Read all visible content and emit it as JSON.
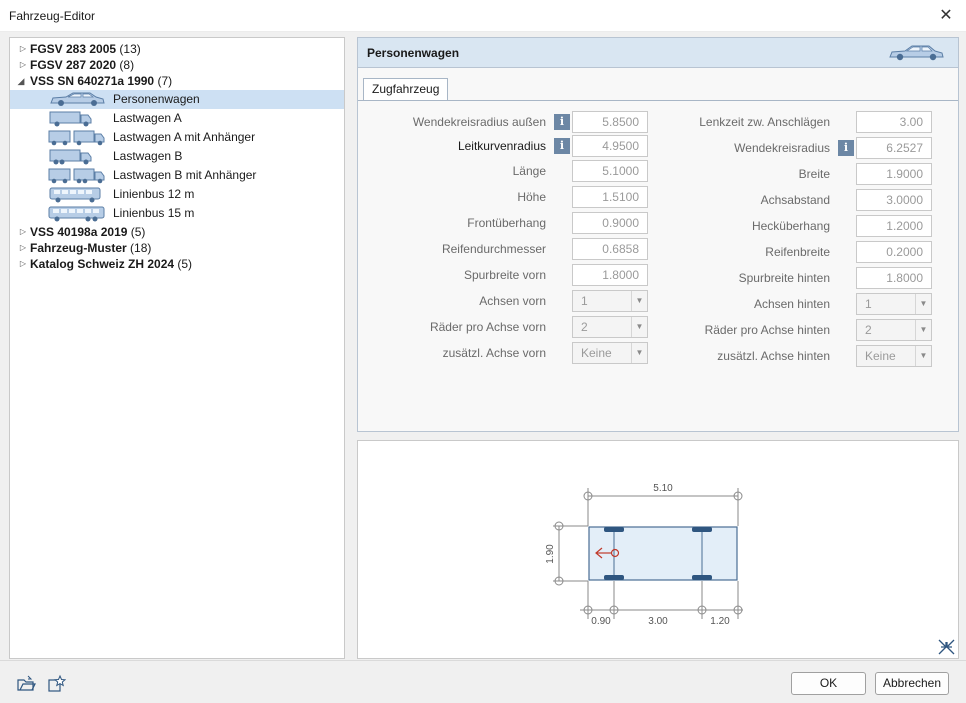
{
  "window": {
    "title": "Fahrzeug-Editor",
    "close_glyph": "✕"
  },
  "tree": {
    "groups": [
      {
        "name": "FGSV 283 2005",
        "count": "(13)"
      },
      {
        "name": "FGSV 287 2020",
        "count": "(8)"
      },
      {
        "name": "VSS SN 640271a 1990",
        "count": "(7)"
      },
      {
        "name": "VSS 40198a 2019",
        "count": "(5)"
      },
      {
        "name": "Fahrzeug-Muster",
        "count": "(18)"
      },
      {
        "name": "Katalog Schweiz ZH 2024",
        "count": "(5)"
      }
    ],
    "children": [
      {
        "label": "Personenwagen",
        "icon": "car-icon"
      },
      {
        "label": "Lastwagen A",
        "icon": "truck-icon"
      },
      {
        "label": "Lastwagen A mit Anhänger",
        "icon": "truck-trailer-icon"
      },
      {
        "label": "Lastwagen B",
        "icon": "truck-icon"
      },
      {
        "label": "Lastwagen B mit Anhänger",
        "icon": "truck-trailer-icon"
      },
      {
        "label": "Linienbus 12 m",
        "icon": "bus-icon"
      },
      {
        "label": "Linienbus 15 m",
        "icon": "bus-icon"
      }
    ],
    "selected": "Personenwagen"
  },
  "panel": {
    "title": "Personenwagen",
    "tab": "Zugfahrzeug",
    "left_fields": [
      {
        "label": "Wendekreisradius außen",
        "value": "5.8500"
      },
      {
        "label": "Leitkurvenradius",
        "value": "4.9500"
      },
      {
        "label": "Länge",
        "value": "5.1000"
      },
      {
        "label": "Höhe",
        "value": "1.5100"
      },
      {
        "label": "Frontüberhang",
        "value": "0.9000"
      },
      {
        "label": "Reifendurchmesser",
        "value": "0.6858"
      },
      {
        "label": "Spurbreite vorn",
        "value": "1.8000"
      },
      {
        "label": "Achsen vorn",
        "value": "1"
      },
      {
        "label": "Räder pro Achse vorn",
        "value": "2"
      },
      {
        "label": "zusätzl. Achse vorn",
        "value": "Keine"
      }
    ],
    "right_fields": [
      {
        "label": "Lenkzeit zw. Anschlägen",
        "value": "3.00"
      },
      {
        "label": "Wendekreisradius",
        "value": "6.2527"
      },
      {
        "label": "Breite",
        "value": "1.9000"
      },
      {
        "label": "Achsabstand",
        "value": "3.0000"
      },
      {
        "label": "Hecküberhang",
        "value": "1.2000"
      },
      {
        "label": "Reifenbreite",
        "value": "0.2000"
      },
      {
        "label": "Spurbreite hinten",
        "value": "1.8000"
      },
      {
        "label": "Achsen hinten",
        "value": "1"
      },
      {
        "label": "Räder pro Achse hinten",
        "value": "2"
      },
      {
        "label": "zusätzl. Achse hinten",
        "value": "Keine"
      }
    ],
    "info_glyph": "i"
  },
  "preview": {
    "length": "5.10",
    "width": "1.90",
    "front_overhang": "0.90",
    "wheelbase": "3.00",
    "rear_overhang": "1.20"
  },
  "buttons": {
    "ok": "OK",
    "cancel": "Abbrechen"
  },
  "colors": {
    "selection": "#cde0f3",
    "header": "#d9e6f2",
    "vehicle_fill": "#e3eef8",
    "vehicle_stroke": "#4a6d94",
    "direction": "#c0392b"
  }
}
